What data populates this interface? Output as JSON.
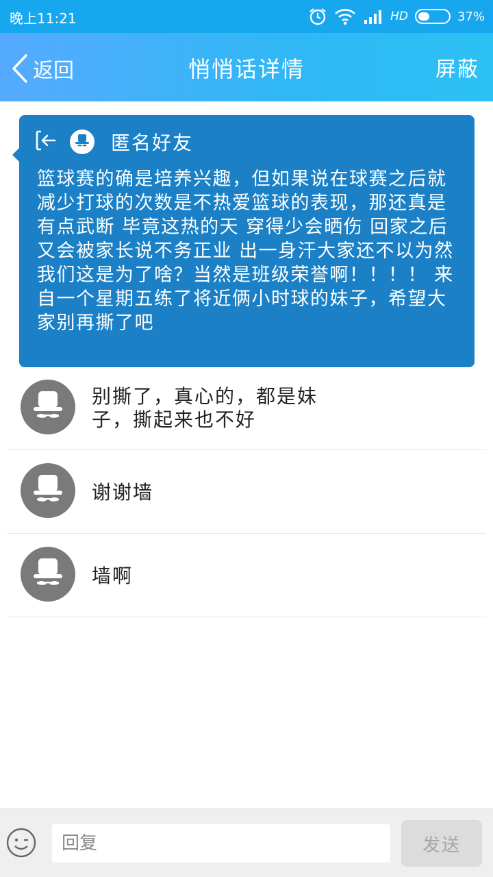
{
  "status_bar": {
    "time": "晚上11:21",
    "network": "HD",
    "battery": "37%",
    "battery_level": 0.37,
    "icons": [
      "alarm-icon",
      "wifi-icon",
      "signal-icon",
      "battery-icon"
    ]
  },
  "header": {
    "back_label": "返回",
    "title": "悄悄话详情",
    "block_label": "屏蔽"
  },
  "post": {
    "author": "匿名好友",
    "content": "篮球赛的确是培养兴趣，但如果说在球赛之后就减少打球的次数是不热爱篮球的表现，那还真是有点武断 毕竟这热的天 穿得少会晒伤 回家之后又会被家长说不务正业 出一身汗大家还不以为然 我们这是为了啥？当然是班级荣誉啊！！！！ 来自一个星期五练了将近俩小时球的妹子，希望大家别再撕了吧"
  },
  "comments": [
    {
      "line1": "别撕了，真心的，都是妹",
      "line2": "子，撕起来也不好"
    },
    {
      "line1": "谢谢墙",
      "line2": ""
    },
    {
      "line1": "墙啊",
      "line2": ""
    }
  ],
  "input": {
    "placeholder": "回复",
    "send_label": "发送"
  },
  "colors": {
    "status_bar": "#17a7ee",
    "header_gradient_start": "#55aaff",
    "header_gradient_end": "#2cc0f4",
    "post_card": "#1b80c6",
    "avatar_gray": "#7a7a7a"
  }
}
